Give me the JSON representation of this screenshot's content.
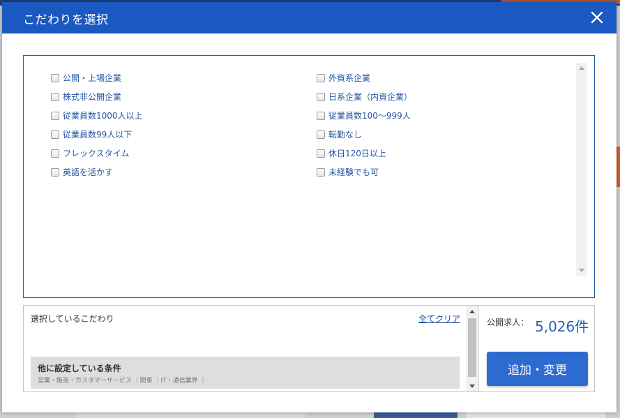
{
  "modal": {
    "title": "こだわりを選択",
    "close_icon": "close-icon"
  },
  "options": {
    "left": [
      "公開・上場企業",
      "株式非公開企業",
      "従業員数1000人以上",
      "従業員数99人以下",
      "フレックスタイム",
      "英語を活かす"
    ],
    "right": [
      "外資系企業",
      "日系企業（内資企業）",
      "従業員数100〜999人",
      "転勤なし",
      "休日120日以上",
      "未経験でも可"
    ]
  },
  "selected": {
    "title": "選択しているこだわり",
    "clear_label": "全てクリア",
    "other_title": "他に設定している条件",
    "other_conditions": "営業・販売・カスタマーサービス ｜関東 ｜IT・通信業界 ｜"
  },
  "summary": {
    "count_label": "公開求人：",
    "count_value": "5,026件",
    "add_button": "追加・変更"
  },
  "colors": {
    "header": "#1a59c2",
    "link": "#2355a5",
    "button": "#2e6bd0"
  }
}
